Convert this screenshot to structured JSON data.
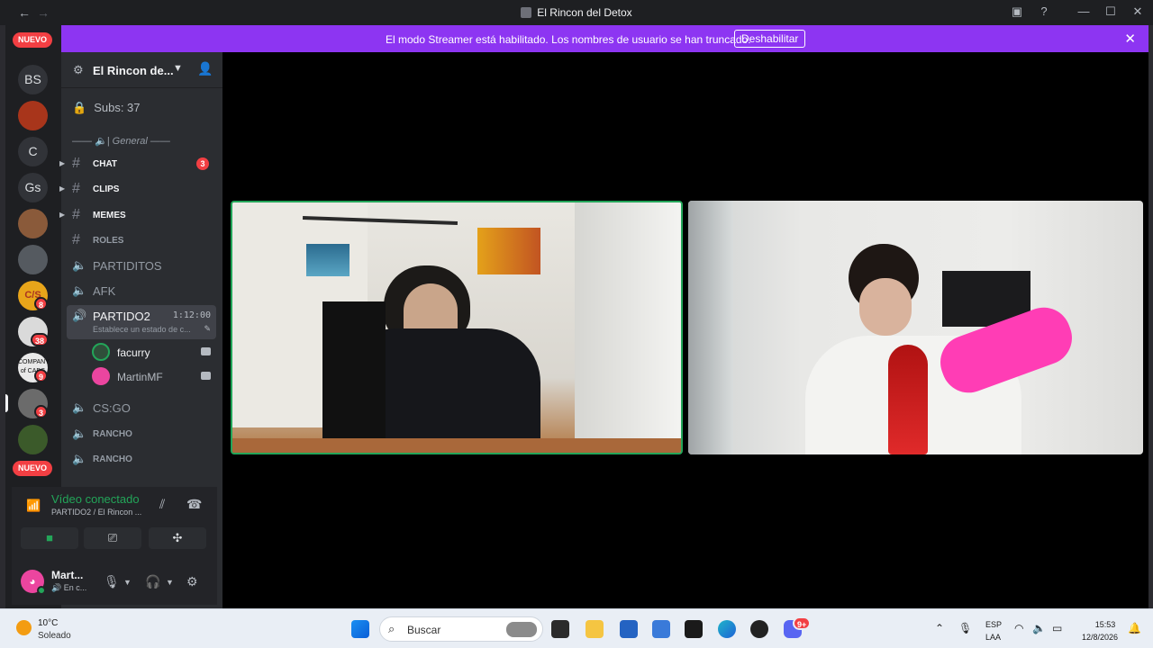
{
  "window": {
    "title": "El Rincon del Detox",
    "back": "←",
    "forward": "→"
  },
  "banner": {
    "message": "El modo Streamer está habilitado. Los nombres de usuario se han truncado.",
    "button": "Deshabilitar",
    "close": "✕"
  },
  "rail": {
    "new_top": "NUEVO",
    "new_bottom": "NUEVO",
    "servers": [
      "BS",
      "C",
      "Gs"
    ],
    "csgo_text": "C/S",
    "company_text": "COMPANY of CADS",
    "badges": [
      "8",
      "38",
      "9",
      "3"
    ]
  },
  "server": {
    "name": "El Rincon de...",
    "lock_channel": "Subs: 37",
    "category": "—— 🔈| General ——",
    "channels": [
      {
        "label": "CHAT",
        "badge": "3"
      },
      {
        "label": "CLIPS"
      },
      {
        "label": "MEMES"
      },
      {
        "label": "ROLES"
      },
      {
        "label": "PARTIDITOS"
      },
      {
        "label": "AFK"
      }
    ],
    "active_voice": {
      "label": "PARTIDO2",
      "time": "1:12:00",
      "status": "Establece un estado de c..."
    },
    "voice_users": [
      "facurry",
      "MartinMF"
    ],
    "voice_channels_after": [
      "CS:GO",
      "RANCHO",
      "RANCHO"
    ]
  },
  "voice_panel": {
    "status": "Vídeo conectado",
    "location": "PARTIDO2 / El Rincon ...",
    "user_name": "Mart...",
    "user_status": "En c..."
  },
  "taskbar": {
    "weather_temp": "10°C",
    "weather_desc": "Soleado",
    "search_placeholder": "Buscar",
    "lang_1": "ESP",
    "lang_2": "LAA",
    "time": "15:53",
    "date": "12/8/2026",
    "discord_badge": "9+"
  },
  "colors": {
    "banner": "#8d35f2",
    "speaking_border": "#23a559",
    "mention_badge": "#f23f43"
  }
}
